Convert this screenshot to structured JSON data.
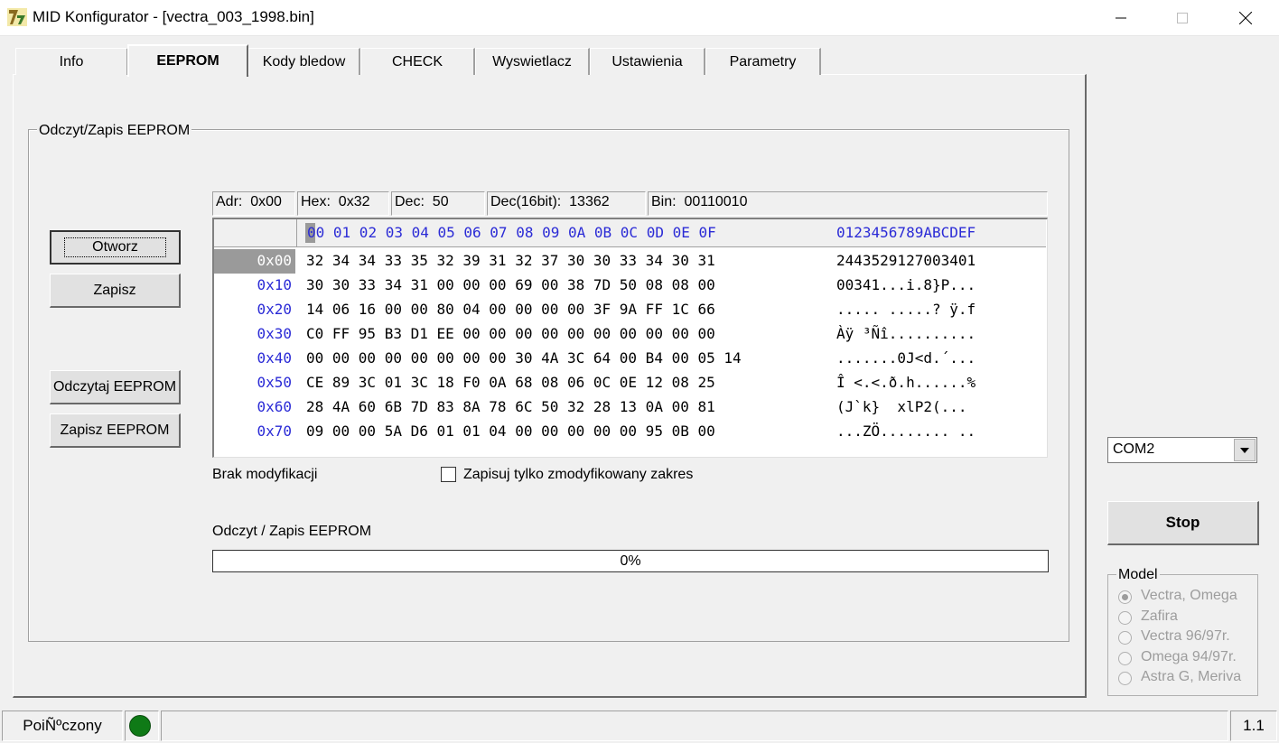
{
  "window": {
    "title": "MID Konfigurator - [vectra_003_1998.bin]",
    "minimize": "—",
    "maximize": "☐",
    "close": "✕"
  },
  "tabs": [
    {
      "label": "Info"
    },
    {
      "label": "EEPROM",
      "active": true
    },
    {
      "label": "Kody bledow"
    },
    {
      "label": "CHECK"
    },
    {
      "label": "Wyswietlacz"
    },
    {
      "label": "Ustawienia"
    },
    {
      "label": "Parametry"
    }
  ],
  "group": {
    "title": "Odczyt/Zapis EEPROM"
  },
  "buttons": {
    "otworz": "Otworz",
    "zapisz": "Zapisz",
    "odczytaj": "Odczytaj EEPROM",
    "zapisz_eeprom": "Zapisz EEPROM"
  },
  "info": {
    "adr": "Adr:  0x00",
    "hex": "Hex:  0x32",
    "dec": "Dec:  50",
    "dec16": "Dec(16bit):  13362",
    "bin": "Bin:  00110010"
  },
  "hex": {
    "columns": "0 01 02 03 04 05 06 07 08 09 0A 0B 0C 0D 0E 0F",
    "cursor_char": "0",
    "ascii_header": "0123456789ABCDEF",
    "rows": [
      {
        "addr": "0x00",
        "bytes": "32 34 34 33 35 32 39 31 32 37 30 30 33 34 30 31",
        "ascii": "2443529127003401"
      },
      {
        "addr": "0x10",
        "bytes": "30 30 33 34 31 00 00 00 69 00 38 7D 50 08 08 00",
        "ascii": "00341...i.8}P..."
      },
      {
        "addr": "0x20",
        "bytes": "14 06 16 00 00 80 04 00 00 00 00 3F 9A FF 1C 66",
        "ascii": "..... .....? ÿ.f"
      },
      {
        "addr": "0x30",
        "bytes": "C0 FF 95 B3 D1 EE 00 00 00 00 00 00 00 00 00 00",
        "ascii": "Àÿ ³Ñî.........."
      },
      {
        "addr": "0x40",
        "bytes": "00 00 00 00 00 00 00 00 30 4A 3C 64 00 B4 00 05 14",
        "ascii": ".......0J<d.´..."
      },
      {
        "addr": "0x50",
        "bytes": "CE 89 3C 01 3C 18 F0 0A 68 08 06 0C 0E 12 08 25",
        "ascii": "Î <.<.ð.h......%"
      },
      {
        "addr": "0x60",
        "bytes": "28 4A 60 6B 7D 83 8A 78 6C 50 32 28 13 0A 00 81",
        "ascii": "(J`k}  xlP2(..."
      },
      {
        "addr": "0x70",
        "bytes": "09 00 00 5A D6 01 01 04 00 00 00 00 00 95 0B 00",
        "ascii": "...ZÖ........ .."
      }
    ]
  },
  "status_mod": "Brak modyfikacji",
  "checkbox_label": "Zapisuj tylko zmodyfikowany zakres",
  "progress": {
    "label": "Odczyt / Zapis EEPROM",
    "text": "0%",
    "value": 0
  },
  "port": {
    "selected": "COM2"
  },
  "stop_label": "Stop",
  "model": {
    "title": "Model",
    "options": [
      {
        "label": "Vectra, Omega",
        "checked": true
      },
      {
        "label": "Zafira"
      },
      {
        "label": "Vectra 96/97r."
      },
      {
        "label": "Omega 94/97r."
      },
      {
        "label": "Astra G, Meriva"
      }
    ]
  },
  "statusbar": {
    "connection": "PoiÑºczony",
    "version": "1.1",
    "led_color": "#0f7a16"
  }
}
